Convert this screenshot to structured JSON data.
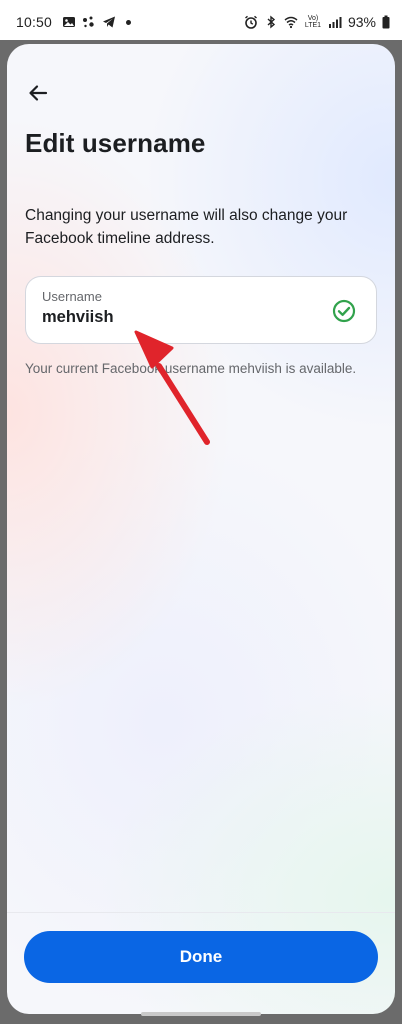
{
  "status_bar": {
    "time": "10:50",
    "network_label": "Vo) LTE1",
    "battery": "93%"
  },
  "screen": {
    "title": "Edit username",
    "description": "Changing your username will also change your Facebook timeline address.",
    "field": {
      "label": "Username",
      "value": "mehviish",
      "status_icon": "check-circle-icon"
    },
    "helper_text": "Your current Facebook username mehviish is available.",
    "done_label": "Done"
  },
  "colors": {
    "primary": "#0a66e4",
    "success": "#31a24c",
    "annotation_arrow": "#e0242b"
  }
}
